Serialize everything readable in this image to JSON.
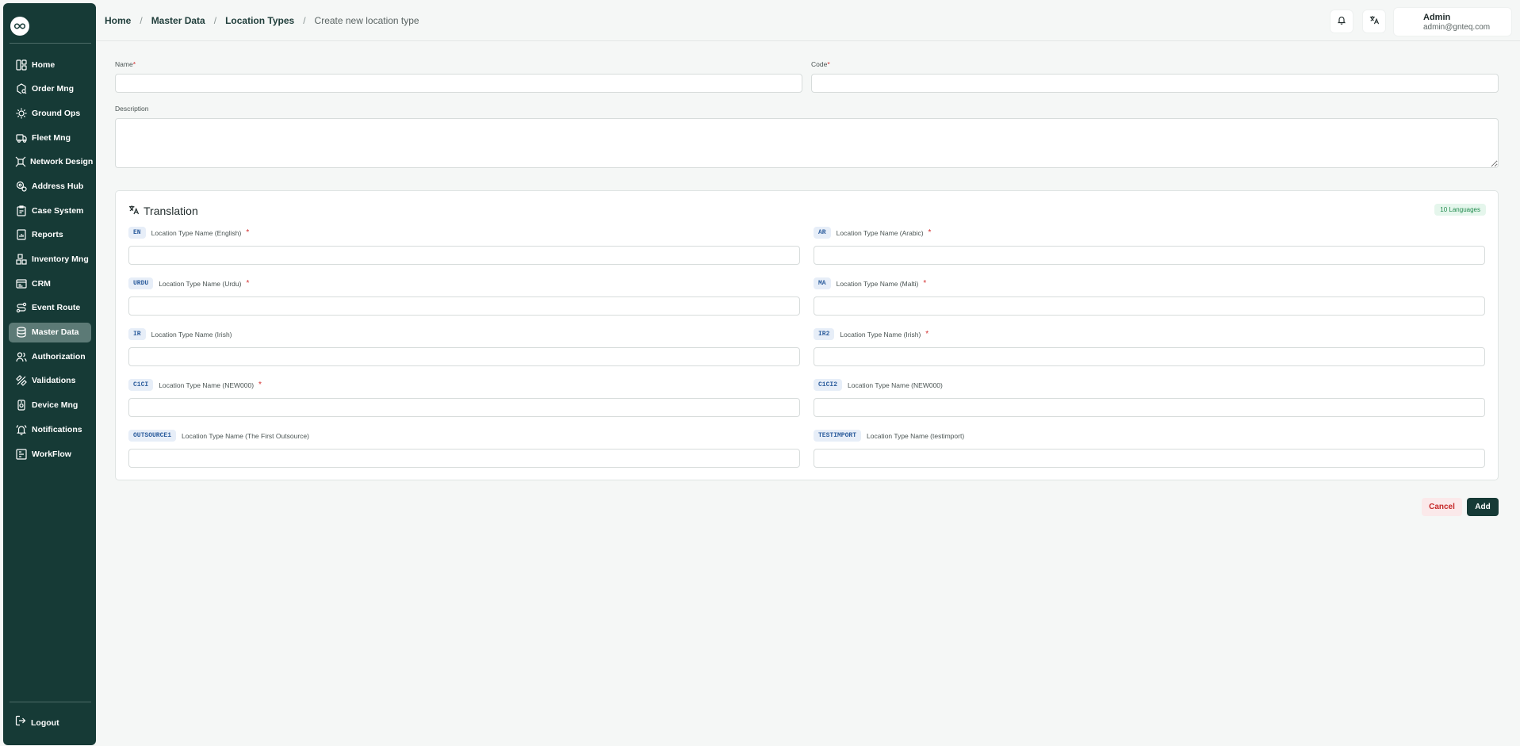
{
  "sidebar": {
    "items": [
      {
        "label": "Home",
        "icon": "layout-dashboard-icon"
      },
      {
        "label": "Order Mng",
        "icon": "package-search-icon"
      },
      {
        "label": "Ground Ops",
        "icon": "sun-cog-icon"
      },
      {
        "label": "Fleet Mng",
        "icon": "truck-icon"
      },
      {
        "label": "Network Design",
        "icon": "network-icon"
      },
      {
        "label": "Address Hub",
        "icon": "map-pin-icon"
      },
      {
        "label": "Case System",
        "icon": "clipboard-icon"
      },
      {
        "label": "Reports",
        "icon": "report-chart-icon"
      },
      {
        "label": "Inventory Mng",
        "icon": "inventory-icon"
      },
      {
        "label": "CRM",
        "icon": "contact-card-icon"
      },
      {
        "label": "Event Route",
        "icon": "route-icon"
      },
      {
        "label": "Master Data",
        "icon": "database-icon",
        "active": true
      },
      {
        "label": "Authorization",
        "icon": "users-icon"
      },
      {
        "label": "Validations",
        "icon": "ruler-pencil-icon"
      },
      {
        "label": "Device Mng",
        "icon": "device-icon"
      },
      {
        "label": "Notifications",
        "icon": "bell-ring-icon"
      },
      {
        "label": "WorkFlow",
        "icon": "workflow-icon"
      }
    ],
    "logout_label": "Logout"
  },
  "breadcrumb": {
    "home": "Home",
    "master_data": "Master Data",
    "location_types": "Location Types",
    "current": "Create new location type",
    "separator": "/"
  },
  "user": {
    "name": "Admin",
    "email": "admin@gnteq.com"
  },
  "form": {
    "name_label": "Name",
    "code_label": "Code",
    "description_label": "Description",
    "required_mark": "*"
  },
  "translation": {
    "title": "Translation",
    "languages_badge": "10 Languages",
    "fields": [
      {
        "code": "EN",
        "label": "Location Type Name (English)",
        "required": true
      },
      {
        "code": "AR",
        "label": "Location Type Name (Arabic)",
        "required": true
      },
      {
        "code": "URDU",
        "label": "Location Type Name (Urdu)",
        "required": true
      },
      {
        "code": "MA",
        "label": "Location Type Name (Malti)",
        "required": true
      },
      {
        "code": "IR",
        "label": "Location Type Name (Irish)",
        "required": false
      },
      {
        "code": "IR2",
        "label": "Location Type Name (Irish)",
        "required": true
      },
      {
        "code": "C1CI",
        "label": "Location Type Name (NEW000)",
        "required": true
      },
      {
        "code": "C1CI2",
        "label": "Location Type Name (NEW000)",
        "required": false
      },
      {
        "code": "OUTSOURCE1",
        "label": "Location Type Name (The First Outsource)",
        "required": false
      },
      {
        "code": "TESTIMPORT",
        "label": "Location Type Name (testimport)",
        "required": false
      }
    ]
  },
  "actions": {
    "cancel": "Cancel",
    "add": "Add"
  },
  "colors": {
    "sidebar_bg": "#163a36",
    "active_item": "#5c7a76",
    "required": "#d32f2f",
    "badge_green": "#1f8a4c"
  }
}
